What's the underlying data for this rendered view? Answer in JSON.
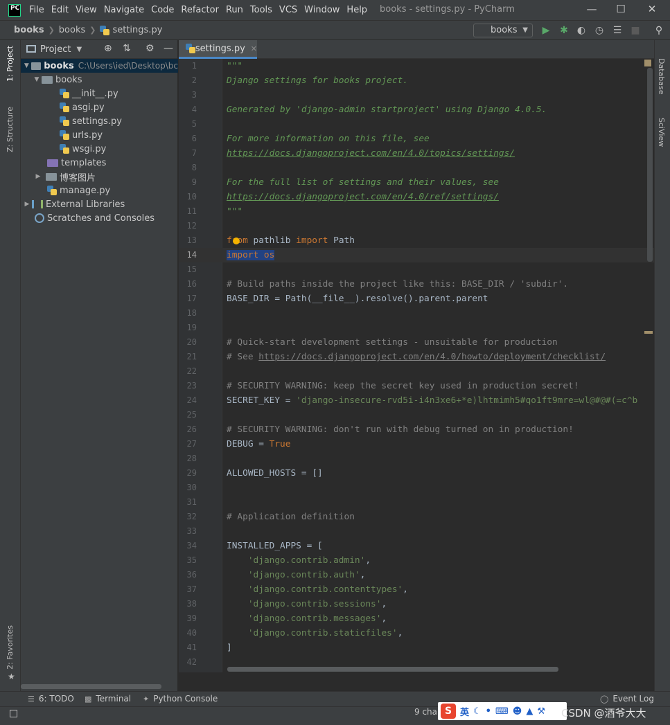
{
  "menubar": {
    "items": [
      "File",
      "Edit",
      "View",
      "Navigate",
      "Code",
      "Refactor",
      "Run",
      "Tools",
      "VCS",
      "Window",
      "Help"
    ],
    "window_title": "books - settings.py - PyCharm",
    "logo_text": "PC"
  },
  "navbar": {
    "crumbs": [
      "books",
      "books",
      "settings.py"
    ],
    "run_config": "books"
  },
  "left_tabs": {
    "project": "1: Project",
    "structure": "Z: Structure",
    "favorites": "2: Favorites"
  },
  "right_tabs": {
    "database": "Database",
    "sciview": "SciView"
  },
  "project_panel": {
    "title": "Project",
    "root": {
      "name": "books",
      "path": "C:\\Users\\ied\\Desktop\\bc"
    },
    "items": [
      {
        "label": "books"
      },
      {
        "label": "__init__.py"
      },
      {
        "label": "asgi.py"
      },
      {
        "label": "settings.py"
      },
      {
        "label": "urls.py"
      },
      {
        "label": "wsgi.py"
      },
      {
        "label": "templates"
      },
      {
        "label": "博客图片"
      },
      {
        "label": "manage.py"
      },
      {
        "label": "External Libraries"
      },
      {
        "label": "Scratches and Consoles"
      }
    ]
  },
  "editor": {
    "tab_label": "settings.py",
    "current_line": 14,
    "lines": [
      {
        "n": "1",
        "t": "\"\"\""
      },
      {
        "n": "2",
        "t": "Django settings for books project."
      },
      {
        "n": "3",
        "t": ""
      },
      {
        "n": "4",
        "t": "Generated by 'django-admin startproject' using Django 4.0.5."
      },
      {
        "n": "5",
        "t": ""
      },
      {
        "n": "6",
        "t": "For more information on this file, see"
      },
      {
        "n": "7",
        "t": "https://docs.djangoproject.com/en/4.0/topics/settings/"
      },
      {
        "n": "8",
        "t": ""
      },
      {
        "n": "9",
        "t": "For the full list of settings and their values, see"
      },
      {
        "n": "10",
        "t": "https://docs.djangoproject.com/en/4.0/ref/settings/"
      },
      {
        "n": "11",
        "t": "\"\"\""
      },
      {
        "n": "12",
        "t": ""
      },
      {
        "n": "13",
        "kw1": "from",
        "t": " pathlib ",
        "kw2": "import",
        "t2": " Path"
      },
      {
        "n": "14",
        "sel": "import os"
      },
      {
        "n": "15",
        "t": ""
      },
      {
        "n": "16",
        "cmt": "# Build paths inside the project like this: BASE_DIR / 'subdir'."
      },
      {
        "n": "17",
        "t": "BASE_DIR = Path(__file__).resolve().parent.parent"
      },
      {
        "n": "18",
        "t": ""
      },
      {
        "n": "19",
        "t": ""
      },
      {
        "n": "20",
        "cmt": "# Quick-start development settings - unsuitable for production"
      },
      {
        "n": "21",
        "cmt": "# See ",
        "url": "https://docs.djangoproject.com/en/4.0/howto/deployment/checklist/"
      },
      {
        "n": "22",
        "t": ""
      },
      {
        "n": "23",
        "cmt": "# SECURITY WARNING: keep the secret key used in production secret!"
      },
      {
        "n": "24",
        "t": "SECRET_KEY = ",
        "str": "'django-insecure-rvd5i-i4n3xe6+*e)lhtmimh5#qo1ft9mre=wl@#@#(=c^b"
      },
      {
        "n": "25",
        "t": ""
      },
      {
        "n": "26",
        "cmt": "# SECURITY WARNING: don't run with debug turned on in production!"
      },
      {
        "n": "27",
        "t": "DEBUG = ",
        "kw2": "True"
      },
      {
        "n": "28",
        "t": ""
      },
      {
        "n": "29",
        "t": "ALLOWED_HOSTS = []"
      },
      {
        "n": "30",
        "t": ""
      },
      {
        "n": "31",
        "t": ""
      },
      {
        "n": "32",
        "cmt": "# Application definition"
      },
      {
        "n": "33",
        "t": ""
      },
      {
        "n": "34",
        "t": "INSTALLED_APPS = ["
      },
      {
        "n": "35",
        "t": "    ",
        "str": "'django.contrib.admin'",
        "t2": ","
      },
      {
        "n": "36",
        "t": "    ",
        "str": "'django.contrib.auth'",
        "t2": ","
      },
      {
        "n": "37",
        "t": "    ",
        "str": "'django.contrib.contenttypes'",
        "t2": ","
      },
      {
        "n": "38",
        "t": "    ",
        "str": "'django.contrib.sessions'",
        "t2": ","
      },
      {
        "n": "39",
        "t": "    ",
        "str": "'django.contrib.messages'",
        "t2": ","
      },
      {
        "n": "40",
        "t": "    ",
        "str": "'django.contrib.staticfiles'",
        "t2": ","
      },
      {
        "n": "41",
        "t": "]"
      },
      {
        "n": "42",
        "t": ""
      }
    ]
  },
  "statusbar": {
    "todo": "6: TODO",
    "terminal": "Terminal",
    "python_console": "Python Console",
    "event_log": "Event Log",
    "chars": "9 char"
  },
  "ime": {
    "lang": "英",
    "watermark": "CSDN @酒爷大大"
  },
  "colors": {
    "bg": "#2b2b2b",
    "panel": "#3c3f41",
    "accent": "#4a88c7",
    "keyword": "#cc7832",
    "string": "#6a8759",
    "doc": "#629755",
    "comment": "#808080"
  }
}
